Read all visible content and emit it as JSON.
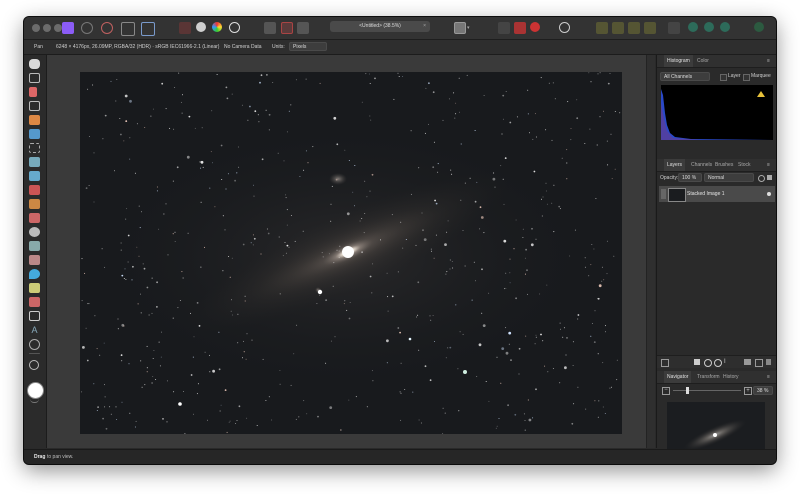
{
  "app": {
    "document_tab": "<Untitled> (38.5%)"
  },
  "context_bar": {
    "tool_name": "Pan",
    "image_info": "6248 × 4176px, 26.09MP, RGBA/32 (HDR) · sRGB IEC61966-2.1 (Linear)",
    "camera_data": "No Camera Data",
    "units_label": "Units:",
    "units_value": "Pixels"
  },
  "status": {
    "hint_bold": "Drag",
    "hint_text": " to pan view."
  },
  "histogram_panel": {
    "tabs": [
      "Histogram",
      "Color"
    ],
    "channels": "All Channels",
    "layer_label": "Layer",
    "marquee_label": "Marquee"
  },
  "layers_panel": {
    "tabs": [
      "Layers",
      "Channels",
      "Brushes",
      "Stock"
    ],
    "opacity_label": "Opacity:",
    "opacity_value": "100 %",
    "blend_mode": "Normal",
    "layers": [
      {
        "name": "Stacked Image 1"
      }
    ]
  },
  "navigator_panel": {
    "tabs": [
      "Navigator",
      "Transform",
      "History"
    ],
    "zoom_value": "38 %",
    "zoom_fraction": 0.2
  },
  "colors": {
    "accent": "#8b5cf6",
    "background": "#2a2a2a",
    "histogram_blue": "#2a49c8"
  }
}
